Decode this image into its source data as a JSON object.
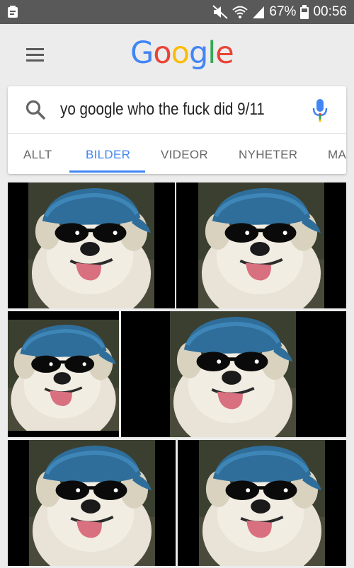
{
  "status_bar": {
    "icons": [
      "notification-icon",
      "mute-icon",
      "wifi-icon",
      "signal-icon",
      "battery-icon"
    ],
    "battery_percent": "67%",
    "time": "00:56"
  },
  "header": {
    "menu_icon": "hamburger-menu-icon",
    "logo": {
      "letters": [
        "G",
        "o",
        "o",
        "g",
        "l",
        "e"
      ],
      "colors": [
        "#4285F4",
        "#EA4335",
        "#FBBC05",
        "#4285F4",
        "#34A853",
        "#EA4335"
      ]
    }
  },
  "search": {
    "icon": "search-icon",
    "query": "yo google who the fuck did 9/11",
    "mic_icon": "microphone-icon"
  },
  "tabs": [
    {
      "label": "ALLT",
      "active": false
    },
    {
      "label": "BILDER",
      "active": true
    },
    {
      "label": "VIDEOR",
      "active": false
    },
    {
      "label": "NYHETER",
      "active": false
    },
    {
      "label": "MA",
      "active": false
    }
  ],
  "colors": {
    "accent": "#4285f4",
    "status_bar": "#595959",
    "page_background": "#ececec"
  },
  "results": {
    "count": 6,
    "image_subject": "white dog wearing blue cap and sunglasses"
  }
}
